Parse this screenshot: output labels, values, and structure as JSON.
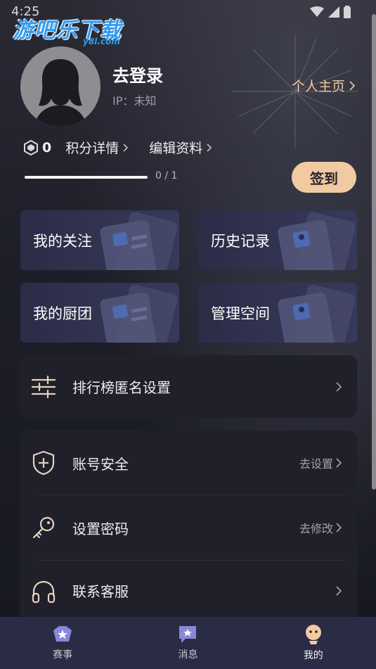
{
  "status_bar": {
    "time": "4:25"
  },
  "watermark": {
    "title": "游吧乐下载",
    "subtitle": "y8l.com"
  },
  "profile": {
    "login_label": "去登录",
    "ip_text": "IP：未知",
    "homepage_label": "个人主页"
  },
  "points": {
    "value": "0",
    "details_label": "积分详情",
    "edit_label": "编辑资料"
  },
  "progress": {
    "text": "0 / 1",
    "fraction": 1.0
  },
  "signin": {
    "label": "签到"
  },
  "cards": [
    {
      "label": "我的关注"
    },
    {
      "label": "历史记录"
    },
    {
      "label": "我的厨团"
    },
    {
      "label": "管理空间"
    }
  ],
  "ranking": {
    "label": "排行榜匿名设置"
  },
  "settings": [
    {
      "label": "账号安全",
      "action": "去设置"
    },
    {
      "label": "设置密码",
      "action": "去修改"
    },
    {
      "label": "联系客服",
      "action": ""
    }
  ],
  "tabs": [
    {
      "label": "赛事",
      "icon": "event-icon",
      "active": false
    },
    {
      "label": "消息",
      "icon": "message-icon",
      "active": false
    },
    {
      "label": "我的",
      "icon": "profile-icon",
      "active": true
    }
  ],
  "colors": {
    "accent": "#f2caa1",
    "background": "#17181f",
    "tabbar": "#2a2b45",
    "card": "#31334f"
  }
}
